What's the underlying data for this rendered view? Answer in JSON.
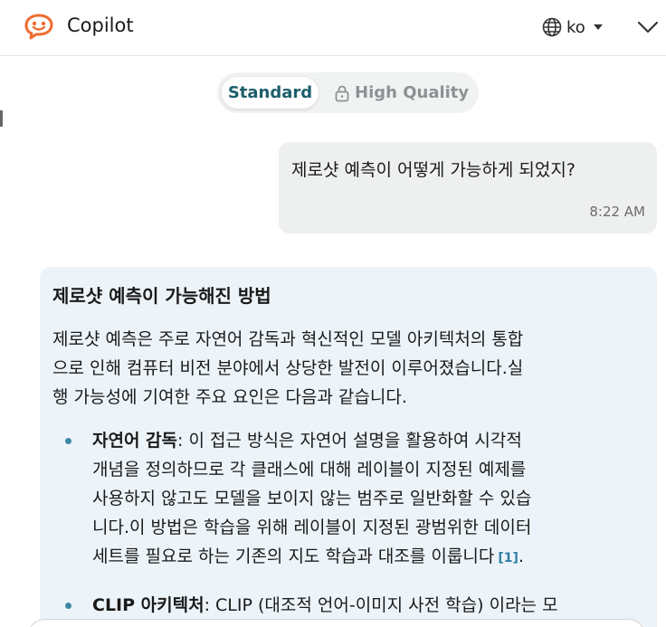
{
  "header": {
    "title": "Copilot",
    "lang_code": "ko"
  },
  "mode": {
    "standard_label": "Standard",
    "high_quality_label": "High Quality",
    "active": "Standard"
  },
  "user_message": {
    "text": "제로샷 예측이 어떻게 가능하게 되었지?",
    "time": "8:22 AM"
  },
  "bot_message": {
    "heading": "제로샷 예측이 가능해진 방법",
    "paragraph_lines": [
      "제로샷 예측은 주로 자연어 감독과 혁신적인 모델 아키텍처의 통합",
      "으로 인해 컴퓨터 비전 분야에서 상당한 발전이 이루어졌습니다.실",
      "행 가능성에 기여한 주요 요인은 다음과 같습니다."
    ],
    "bullets": [
      {
        "title": "자연어 감독",
        "first_rest": ": 이 접근 방식은 자연어 설명을 활용하여 시각적",
        "lines": [
          "개념을 정의하므로 각 클래스에 대해 레이블이 지정된 예제를",
          "사용하지 않고도 모델을 보이지 않는 범주로 일반화할 수 있습",
          "니다.이 방법은 학습을 위해 레이블이 지정된 광범위한 데이터"
        ],
        "last_line": "세트를 필요로 하는 기존의 지도 학습과 대조를 이룹니다",
        "citation": "[1]",
        "end": "."
      },
      {
        "title": "CLIP 아키텍처",
        "first_rest": ": CLIP (대조적 언어-이미지 사전 학습) 이라는 모",
        "lines": [],
        "last_line": "",
        "citation": "",
        "end": ""
      }
    ]
  },
  "colors": {
    "accent": "#1d5f6a",
    "logo": "#f06b2f",
    "bot_bubble": "#edf4f9",
    "user_bubble": "#eef0f0",
    "bullet": "#3d86a6",
    "citation": "#2f7ea8"
  },
  "icons": {
    "logo": "copilot-chat-icon",
    "language": "globe-icon",
    "language_caret": "caret-down-icon",
    "collapse": "chevron-down-icon",
    "lock": "lock-icon"
  }
}
